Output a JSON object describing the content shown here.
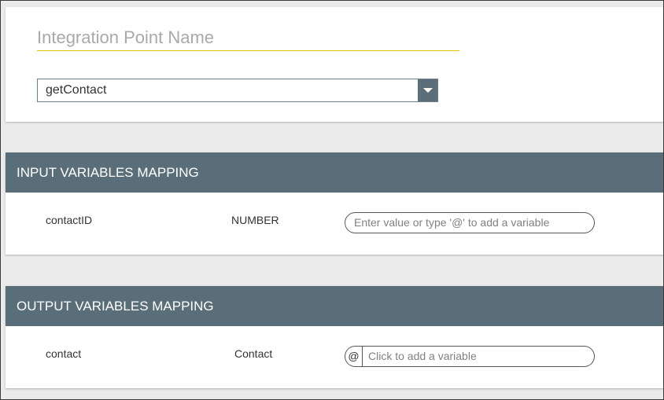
{
  "top": {
    "name_placeholder": "Integration Point Name",
    "operation_select": {
      "value": "getContact"
    }
  },
  "input_section": {
    "title": "INPUT VARIABLES MAPPING",
    "rows": [
      {
        "name": "contactID",
        "type": "NUMBER",
        "placeholder": "Enter value or type '@' to add a variable"
      }
    ]
  },
  "output_section": {
    "title": "OUTPUT VARIABLES MAPPING",
    "rows": [
      {
        "name": "contact",
        "type": "Contact",
        "at_symbol": "@",
        "placeholder": "Click to add a variable"
      }
    ]
  },
  "colors": {
    "header_bg": "#596e79",
    "underline_accent": "#e6c200",
    "select_arrow_bg": "#5b6e79"
  },
  "icons": {
    "select_arrow": "chevron-down-icon",
    "variable_marker": "at-icon"
  }
}
